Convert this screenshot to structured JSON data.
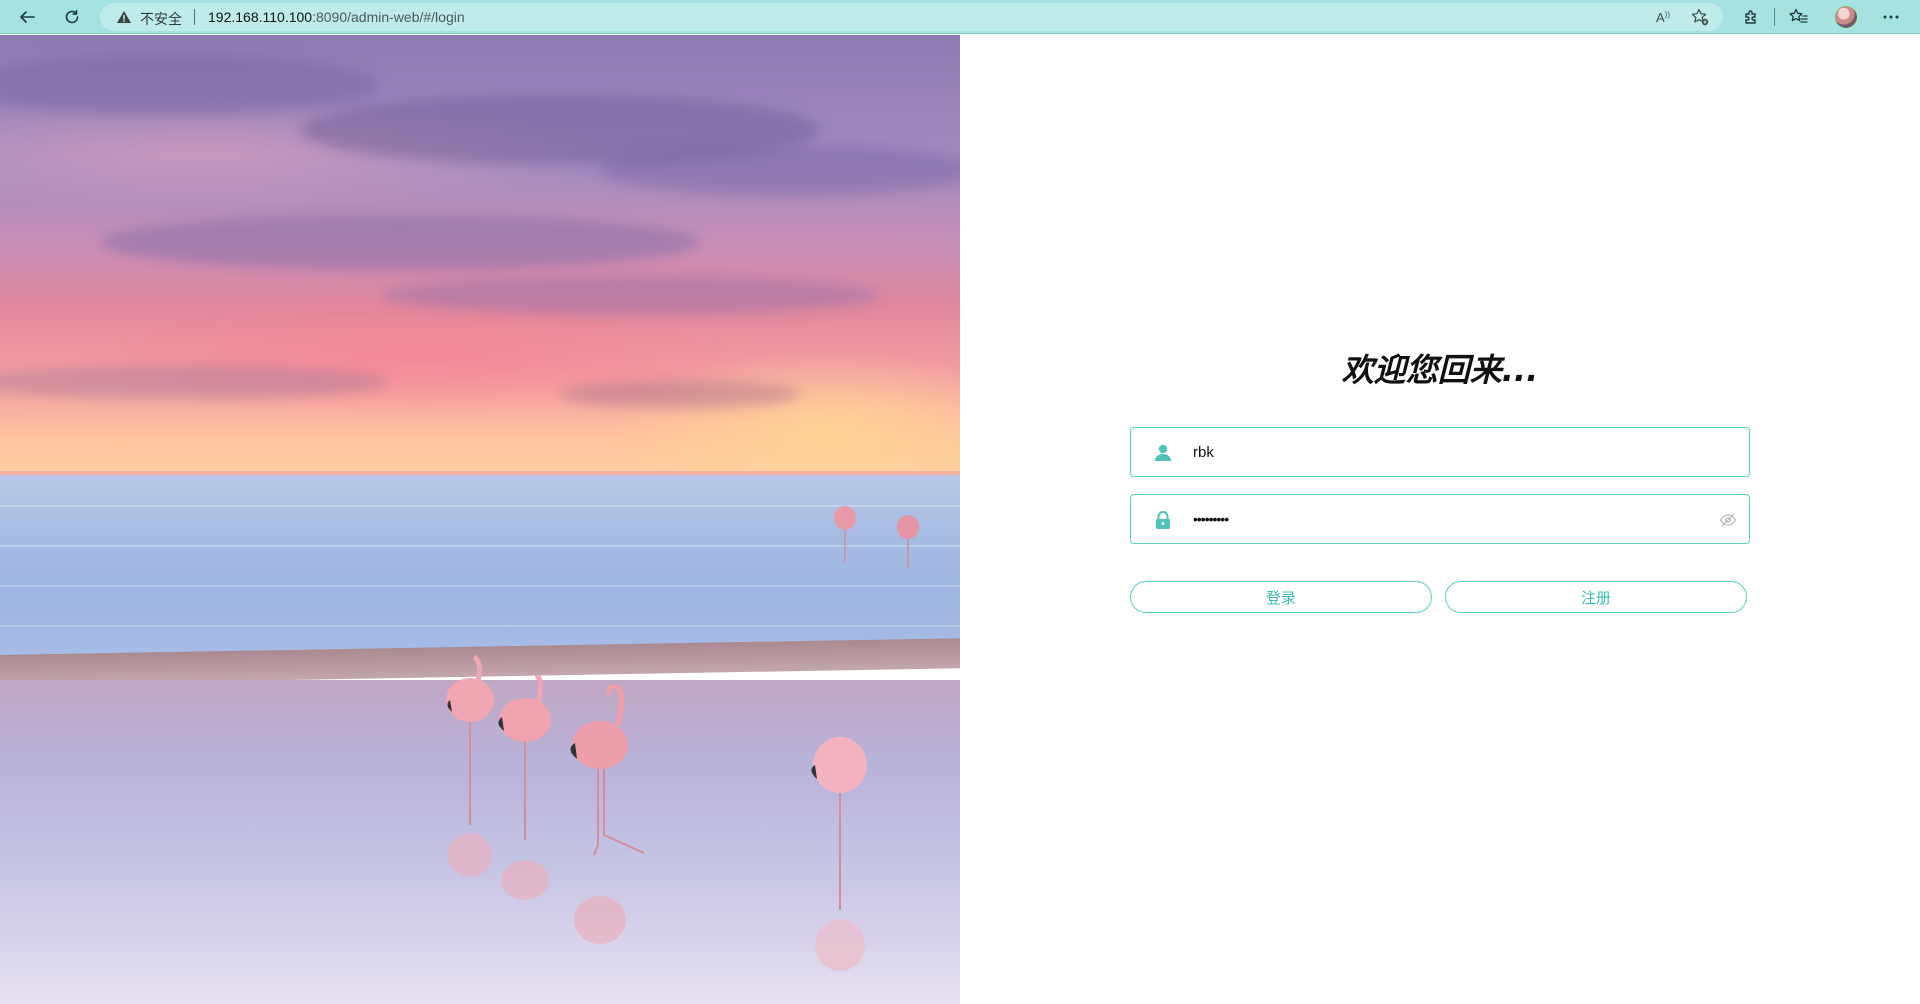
{
  "browser": {
    "security_label": "不安全",
    "url_host": "192.168.110.100",
    "url_path": ":8090/admin-web/#/login",
    "read_aloud_label": "A",
    "chrome_color": "#a6e3e0"
  },
  "login": {
    "welcome_text": "欢迎您回来...",
    "username_value": "rbk",
    "password_value": "•••••••••",
    "login_button": "登录",
    "register_button": "注册",
    "accent_color": "#5ccfc6"
  },
  "icons": {
    "back": "back-arrow-icon",
    "refresh": "refresh-icon",
    "warning": "warning-icon",
    "read_aloud": "read-aloud-icon",
    "favorite_add": "favorite-add-icon",
    "extensions": "extensions-icon",
    "favorites": "favorites-icon",
    "profile": "profile-avatar",
    "more": "more-icon",
    "user": "user-icon",
    "lock": "lock-icon",
    "eye": "eye-icon"
  }
}
